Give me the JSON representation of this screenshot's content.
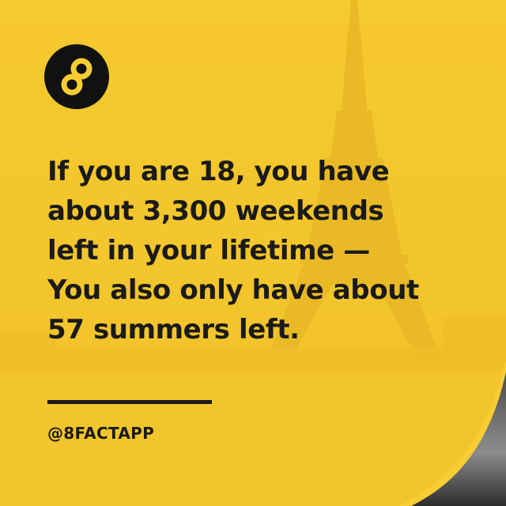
{
  "headline": {
    "lines": [
      "If you are 18, you have",
      "about 3,300 weekends",
      "left in your lifetime —",
      "You also only have about",
      "57 summers left."
    ]
  },
  "footer": {
    "handle": "@8FACTAPP"
  },
  "logo": {
    "icon": "infinity-eight-icon"
  },
  "colors": {
    "brand_yellow": "#f9cd32",
    "text_dark": "#1a1a1a",
    "logo_circle": "#111111"
  }
}
